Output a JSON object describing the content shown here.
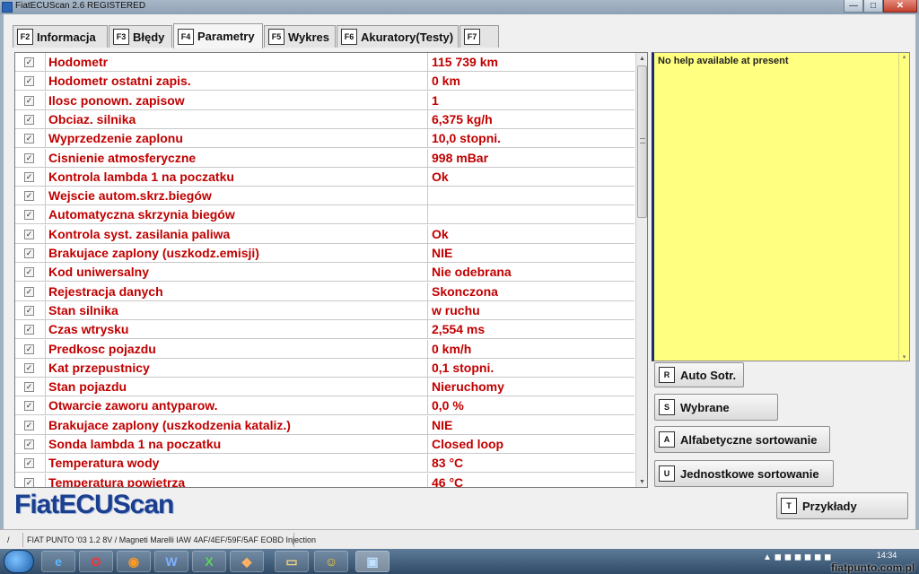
{
  "window": {
    "title": "FiatECUScan 2.6 REGISTERED",
    "min_label": "—",
    "max_label": "□",
    "close_label": "✕"
  },
  "tabs": [
    {
      "key": "F2",
      "label": "Informacja"
    },
    {
      "key": "F3",
      "label": "Błędy"
    },
    {
      "key": "F4",
      "label": "Parametry"
    },
    {
      "key": "F5",
      "label": "Wykres"
    },
    {
      "key": "F6",
      "label": "Akuratory(Testy)"
    },
    {
      "key": "F7",
      "label": ""
    }
  ],
  "active_tab": "Parametry",
  "parameters": [
    {
      "checked": true,
      "name": "Hodometr",
      "value": "115 739 km"
    },
    {
      "checked": true,
      "name": "Hodometr ostatni zapis.",
      "value": "0 km"
    },
    {
      "checked": true,
      "name": "Ilosc ponown. zapisow",
      "value": "1"
    },
    {
      "checked": true,
      "name": "Obciaz. silnika",
      "value": "6,375 kg/h"
    },
    {
      "checked": true,
      "name": "Wyprzedzenie zaplonu",
      "value": "10,0  stopni."
    },
    {
      "checked": true,
      "name": "Cisnienie atmosferyczne",
      "value": "998 mBar"
    },
    {
      "checked": true,
      "name": "Kontrola lambda 1 na poczatku",
      "value": "Ok"
    },
    {
      "checked": true,
      "name": "Wejscie autom.skrz.biegów",
      "value": ""
    },
    {
      "checked": true,
      "name": "Automatyczna skrzynia biegów",
      "value": ""
    },
    {
      "checked": true,
      "name": "Kontrola syst. zasilania paliwa",
      "value": "Ok"
    },
    {
      "checked": true,
      "name": "Brakujace zaplony (uszkodz.emisji)",
      "value": "NIE"
    },
    {
      "checked": true,
      "name": "Kod uniwersalny",
      "value": "Nie odebrana"
    },
    {
      "checked": true,
      "name": "Rejestracja danych",
      "value": "Skonczona"
    },
    {
      "checked": true,
      "name": "Stan silnika",
      "value": "w ruchu"
    },
    {
      "checked": true,
      "name": "Czas wtrysku",
      "value": "2,554 ms"
    },
    {
      "checked": true,
      "name": "Predkosc pojazdu",
      "value": "0 km/h"
    },
    {
      "checked": true,
      "name": "Kat przepustnicy",
      "value": "0,1  stopni."
    },
    {
      "checked": true,
      "name": "Stan pojazdu",
      "value": "Nieruchomy"
    },
    {
      "checked": true,
      "name": "Otwarcie zaworu antyparow.",
      "value": "0,0 %"
    },
    {
      "checked": true,
      "name": "Brakujace zaplony (uszkodzenia kataliz.)",
      "value": "NIE"
    },
    {
      "checked": true,
      "name": "Sonda lambda 1 na poczatku",
      "value": "Closed loop"
    },
    {
      "checked": true,
      "name": "Temperatura wody",
      "value": "83 °C"
    },
    {
      "checked": true,
      "name": "Temperatura powietrza",
      "value": "46 °C"
    }
  ],
  "help": {
    "text": "No help available at present"
  },
  "side_buttons": {
    "auto_sort": {
      "key": "R",
      "label": "Auto Sotr."
    },
    "selected": {
      "key": "S",
      "label": "Wybrane"
    },
    "alpha_sort": {
      "key": "A",
      "label": "Alfabetyczne sortowanie"
    },
    "unit_sort": {
      "key": "U",
      "label": "Jednostkowe sortowanie"
    },
    "examples": {
      "key": "T",
      "label": "Przykłady"
    }
  },
  "logo": "FiatECUScan",
  "status": {
    "left": "/",
    "vehicle": "FIAT PUNTO '03 1.2 8V / Magneti Marelli IAW 4AF/4EF/59F/5AF EOBD Injection"
  },
  "taskbar": {
    "clock": "14:34",
    "watermark": "fiatpunto.com.pl"
  }
}
